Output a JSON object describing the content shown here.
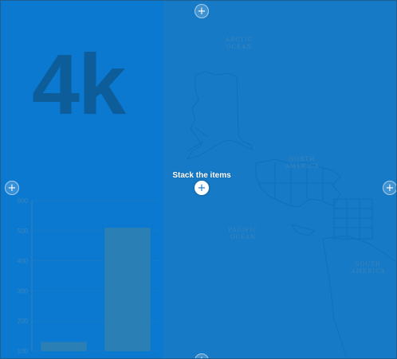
{
  "dashboard": {
    "indicator": {
      "value_text": "4k"
    },
    "drop_hint": {
      "label": "Stack the items"
    },
    "map": {
      "labels": [
        {
          "id": "arctic-ocean",
          "lines": [
            "ARCTIC",
            "OCEAN"
          ]
        },
        {
          "id": "north-america",
          "lines": [
            "NORTH",
            "AMERICA"
          ]
        },
        {
          "id": "pacific-ocean",
          "lines": [
            "PACIFIC",
            "OCEAN"
          ]
        },
        {
          "id": "south-america",
          "lines": [
            "SOUTH",
            "AMERICA"
          ]
        }
      ]
    }
  },
  "chart_data": {
    "type": "bar",
    "categories": [
      "",
      ""
    ],
    "values": [
      130,
      510
    ],
    "yticks": [
      100,
      200,
      300,
      400,
      500,
      600
    ],
    "ylim": [
      100,
      600
    ],
    "grid": true,
    "colors": {
      "bar": "#2a7fb4",
      "tick": "#3a87be",
      "grid": "#3682ba"
    }
  },
  "colors": {
    "overlay": "#0078d7",
    "accent": "#1d77c4"
  }
}
